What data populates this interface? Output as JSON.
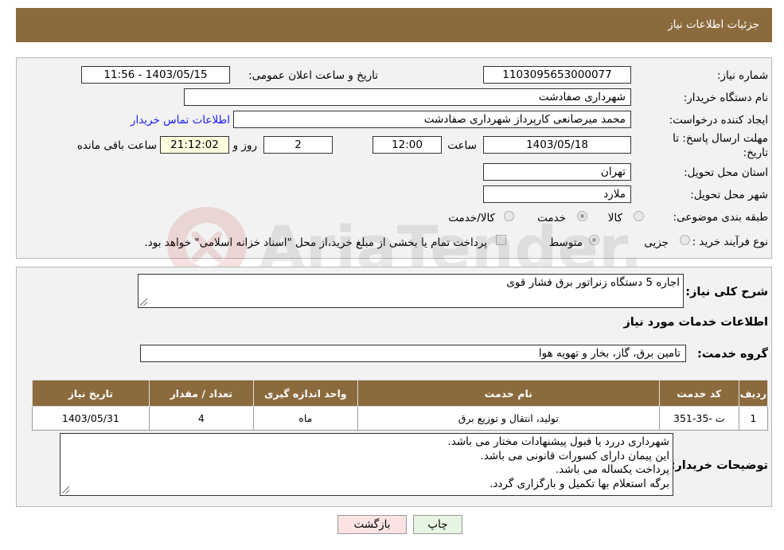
{
  "header": {
    "title": "جزئیات اطلاعات نیاز"
  },
  "form": {
    "need_number_label": "شماره نیاز:",
    "need_number": "1103095653000077",
    "announce_label": "تاریخ و ساعت اعلان عمومی:",
    "announce_value": "1403/05/15 - 11:56",
    "buyer_org_label": "نام دستگاه خریدار:",
    "buyer_org": "شهرداری صفادشت",
    "creator_label": "ایجاد کننده درخواست:",
    "creator": "محمد میرصانعی کارپرداز شهرداری صفادشت",
    "contact_link": "اطلاعات تماس خریدار",
    "deadline_label": "مهلت ارسال پاسخ: تا تاریخ:",
    "deadline_date": "1403/05/18",
    "time_label": "ساعت",
    "deadline_time": "12:00",
    "days_value": "2",
    "days_label": "روز و",
    "remaining_time": "21:12:02",
    "remaining_label": "ساعت باقی مانده",
    "province_label": "استان محل تحویل:",
    "province": "تهران",
    "city_label": "شهر محل تحویل:",
    "city": "ملارد",
    "category_label": "طبقه بندی موضوعی:",
    "category_options": [
      "کالا",
      "خدمت",
      "کالا/خدمت"
    ],
    "category_selected": "خدمت",
    "purchase_type_label": "نوع فرآیند خرید :",
    "purchase_options": [
      "جزیی",
      "متوسط"
    ],
    "purchase_selected": "متوسط",
    "payment_note": "پرداخت تمام یا بخشی از مبلغ خرید،از محل \"اسناد خزانه اسلامی\" خواهد بود."
  },
  "details": {
    "summary_label": "شرح کلی نیاز:",
    "summary": "اجاره 5 دستگاه زنراتور برق فشار قوی",
    "services_heading": "اطلاعات خدمات مورد نیاز",
    "service_group_label": "گروه خدمت:",
    "service_group": "تامین برق، گاز، بخار و تهویه هوا"
  },
  "table": {
    "headers": [
      "ردیف",
      "کد خدمت",
      "نام خدمت",
      "واحد اندازه گیری",
      "تعداد / مقدار",
      "تاریخ نیاز"
    ],
    "rows": [
      [
        "1",
        "ت -35-351",
        "تولید، انتقال و توزیع برق",
        "ماه",
        "4",
        "1403/05/31"
      ]
    ]
  },
  "buyer_notes": {
    "label": "توضیحات خریدار:",
    "lines": [
      "شهرداری دررد یا قبول پیشنهادات مختار می باشد.",
      "این پیمان دارای کسورات قانونی می باشد.",
      "پرداخت یکساله می باشد.",
      "برگه استعلام بها تکمیل و بارگزاری گردد."
    ]
  },
  "buttons": {
    "print": "چاپ",
    "back": "بازگشت"
  },
  "watermark": {
    "text": "AriaTender.neT"
  },
  "colors": {
    "header": "#8b6b3e",
    "panel": "#f2f2f2",
    "link": "#1a1aff",
    "print_btn": "#e6f5e1",
    "back_btn": "#fbe3e3"
  }
}
